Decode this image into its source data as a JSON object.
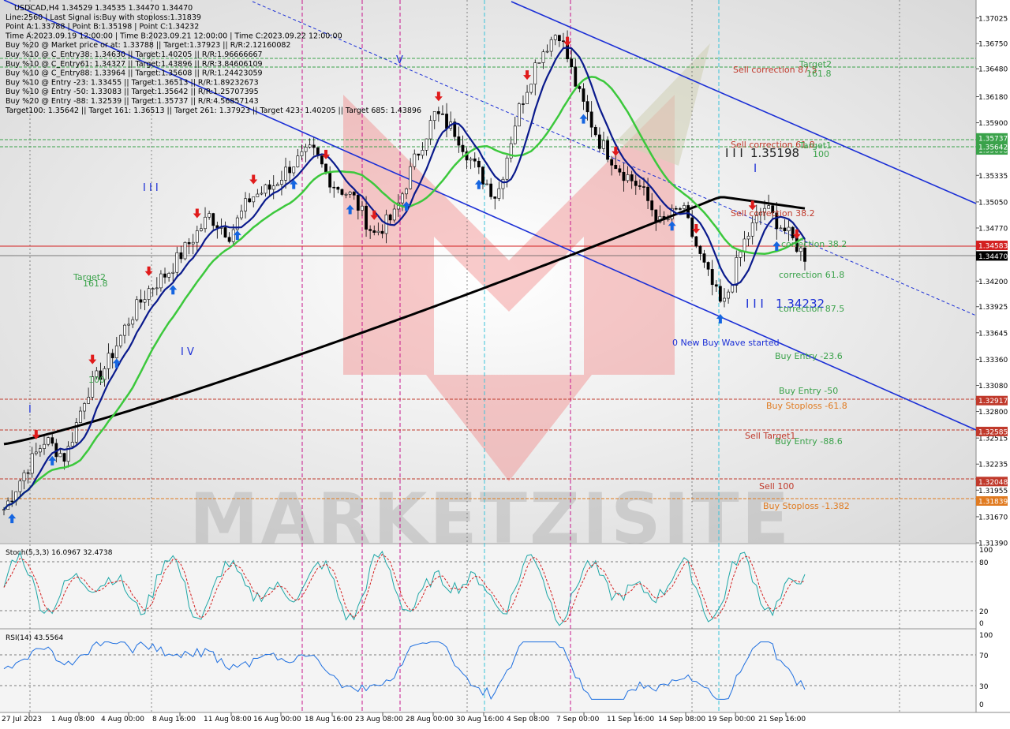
{
  "header": {
    "lines": [
      "USDCAD,H4  1.34529 1.34535 1.34470 1.34470",
      "Line:2560 | Last Signal is:Buy with stoploss:1.31839",
      "Point A:1.33788 | Point B:1.35198 | Point C:1.34232",
      "Time A:2023.09.19 12:00:00 | Time B:2023.09.21 12:00:00 | Time C:2023.09.22 12:00:00",
      "Buy %20 @ Market price or at: 1.33788 || Target:1.37923 || R/R:2.12160082",
      "Buy %10 @ C_Entry38: 1.34630 || Target:1.40205 || R/R:1.96666667",
      "Buy %10 @ C_Entry61: 1.34327 || Target:1.43896 || R/R:3.84606109",
      "Buy %10 @ C_Entry88: 1.33964 || Target:1.35608 || R/R:1.24423059",
      "Buy %10 @ Entry -23: 1.33455 || Target:1.36513 || R/R:1.89232673",
      "Buy %10 @ Entry -50: 1.33083 || Target:1.35642 || R/R:1.25707395",
      "Buy %20 @ Entry -88: 1.32539 || Target:1.35737 || R/R:4.56857143",
      "Target100: 1.35642 || Target 161: 1.36513 || Target 261: 1.37923 || Target 423: 1.40205 || Target 685: 1.43896"
    ]
  },
  "colors": {
    "candle": "#000000",
    "ma_fast": "#0a1a8c",
    "ma_mid": "#3cc83c",
    "ma_slow": "#000000",
    "channel": "#1b2fd6",
    "buy_arrow": "#1565e0",
    "sell_arrow": "#e01b1b",
    "level_green": "#3aa24a",
    "level_red": "#c0392b",
    "level_orange": "#e07a1f",
    "vline": "#c8168c",
    "vline_cyan": "#39c3d9",
    "stoch_main": "#1fa7a7",
    "stoch_signal": "#d32020",
    "rsi": "#1e6fe0",
    "watermark": "#d94a4a"
  },
  "price_axis": {
    "ticks": [
      "1.37025",
      "1.36750",
      "1.36480",
      "1.36180",
      "1.35900",
      "1.35625",
      "1.35335",
      "1.35050",
      "1.34770",
      "1.34200",
      "1.33925",
      "1.33645",
      "1.33360",
      "1.33080",
      "1.32800",
      "1.32515",
      "1.32235",
      "1.31955",
      "1.31670",
      "1.31390"
    ],
    "badges": [
      {
        "text": "1.35675",
        "color": "#3aa24a"
      },
      {
        "text": "1.35608",
        "color": "#3aa24a"
      },
      {
        "text": "1.35737",
        "color": "#3aa24a"
      },
      {
        "text": "1.35642",
        "color": "#3aa24a"
      },
      {
        "text": "1.34583",
        "color": "#d32020"
      },
      {
        "text": "1.34470",
        "color": "#000000"
      },
      {
        "text": "1.32917",
        "color": "#c0392b"
      },
      {
        "text": "1.32585",
        "color": "#c0392b"
      },
      {
        "text": "1.32048",
        "color": "#c0392b"
      },
      {
        "text": "1.31839",
        "color": "#e07a1f"
      }
    ]
  },
  "time_axis": {
    "labels": [
      "27 Jul 2023",
      "1 Aug 08:00",
      "4 Aug 00:00",
      "8 Aug 16:00",
      "11 Aug 08:00",
      "16 Aug 00:00",
      "18 Aug 16:00",
      "23 Aug 08:00",
      "28 Aug 00:00",
      "30 Aug 16:00",
      "4 Sep 08:00",
      "7 Sep 00:00",
      "11 Sep 16:00",
      "14 Sep 08:00",
      "19 Sep 00:00",
      "21 Sep 16:00"
    ]
  },
  "annotations": {
    "sell_correction_875": "Sell correction 87.5",
    "target2_top": "Target2",
    "target2_top_val": "161.8",
    "sell_correction_618": "Sell correction 61.8",
    "target1": "Target1",
    "target1_val": "100",
    "point_b": "1.35198",
    "sell_correction_382": "Sell correction 38.2",
    "correction_382": "correction 38.2",
    "correction_618": "correction 61.8",
    "point_c": "1.34232",
    "correction_875": "correction 87.5",
    "new_wave": "0 New Buy Wave started",
    "buy_entry_236": "Buy Entry -23.6",
    "buy_entry_50": "Buy Entry -50",
    "buy_stoploss_618": "Buy Stoploss -61.8",
    "sell_target1": "Sell Target1",
    "buy_entry_886": "Buy Entry -88.6",
    "sell_100": "Sell 100",
    "buy_stoploss_1382": "Buy Stoploss -1.382",
    "target2_left": "Target2",
    "target2_left_val": "161.8",
    "left_100": "100",
    "wave_I": "I",
    "wave_III": "I I I",
    "wave_IV": "I V",
    "wave_V": "V",
    "wave_B_marks": "I I I",
    "wave_C_marks": "I I I",
    "wave_I_right": "I"
  },
  "indicators": {
    "stoch": {
      "label": "Stoch(5,3,3) 16.0967 32.4738",
      "levels": [
        "100",
        "80",
        "20",
        "0"
      ]
    },
    "rsi": {
      "label": "RSI(14) 43.5564",
      "levels": [
        "100",
        "70",
        "30",
        "0"
      ]
    }
  },
  "watermark": {
    "text": "MARKETZISITE"
  },
  "chart_data": {
    "type": "line",
    "title": "USDCAD,H4",
    "series": [
      {
        "name": "USDCAD",
        "values": [
          1.3175,
          1.3215,
          1.325,
          1.323,
          1.33,
          1.333,
          1.3375,
          1.341,
          1.343,
          1.346,
          1.349,
          1.347,
          1.351,
          1.352,
          1.3545,
          1.356,
          1.3525,
          1.351,
          1.347,
          1.349,
          1.355,
          1.36,
          1.358,
          1.354,
          1.351,
          1.36,
          1.366,
          1.369,
          1.362,
          1.357,
          1.354,
          1.352,
          1.348,
          1.35,
          1.344,
          1.339,
          1.346,
          1.35,
          1.3475,
          1.3447
        ]
      }
    ],
    "ylim": [
      1.3139,
      1.3715
    ],
    "xlabel": "",
    "ylabel": ""
  }
}
